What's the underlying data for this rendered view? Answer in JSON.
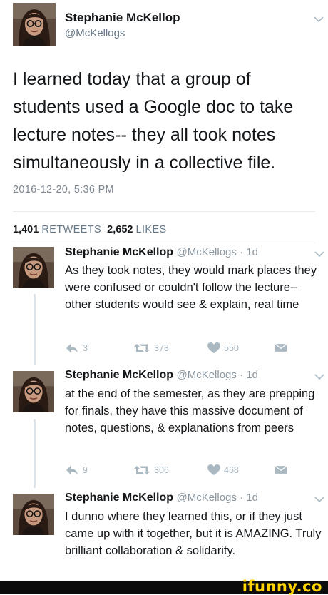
{
  "main_tweet": {
    "author_name": "Stephanie McKellop",
    "author_handle": "@McKellogs",
    "text": "I learned today that a group of students used a Google doc to take lecture notes-- they all took notes simultaneously in a collective file.",
    "timestamp": "2016-12-20, 5:36 PM",
    "retweet_count": "1,401",
    "retweet_label": "RETWEETS",
    "like_count": "2,652",
    "like_label": "LIKES"
  },
  "replies": [
    {
      "author_name": "Stephanie McKellop",
      "author_meta": "@McKellogs · 1d",
      "text": "As they took notes, they would mark places they were confused or couldn't follow the lecture--other students would see & explain, real time",
      "reply_count": "3",
      "retweet_count": "373",
      "like_count": "550"
    },
    {
      "author_name": "Stephanie McKellop",
      "author_meta": "@McKellogs · 1d",
      "text": "at the end of the semester, as they are prepping for finals, they have this massive document of notes, questions, & explanations from peers",
      "reply_count": "9",
      "retweet_count": "306",
      "like_count": "468"
    },
    {
      "author_name": "Stephanie McKellop",
      "author_meta": "@McKellogs · 1d",
      "text": "I dunno where they learned this, or if they just came up with it together, but it is AMAZING. Truly brilliant collaboration & solidarity."
    }
  ],
  "watermark": "ifunny.co",
  "icons": {
    "reply": "reply-icon",
    "retweet": "retweet-icon",
    "like": "heart-icon",
    "dm": "envelope-icon",
    "menu": "chevron-down-icon"
  },
  "colors": {
    "text": "#14171a",
    "muted": "#657786",
    "action_icon": "#aab8c2",
    "watermark": "#ffd400"
  }
}
